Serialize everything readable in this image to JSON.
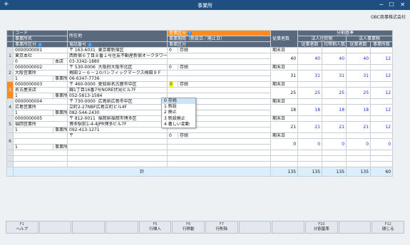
{
  "window": {
    "title": "事業所",
    "app_icon": "+"
  },
  "company": "OBC商事株式会社",
  "headers": {
    "code": "コード",
    "name": "事業所名",
    "office_type": "事業所区分",
    "address": "所在地",
    "phone": "電話番号",
    "biz_type": "営業区分",
    "period": "事業期間（新設日／廃止日）",
    "period2": "事業区分",
    "employees": "従業者数",
    "split": "分割基準",
    "corp_tax": "法人住民税",
    "corp_biz": "法人事業税",
    "col1": "従業者数",
    "col2": "均等割人数",
    "col3": "従業者数",
    "col4": "事業所数"
  },
  "rows": [
    {
      "n": "1",
      "code": "0000000001",
      "name": "東京本社",
      "type_code": "0",
      "type": "本店",
      "zip": "〒 163-6031",
      "addr1": "東京都新宿区",
      "addr2": "西新宿６丁目８番１号住友不動産新宿オークタワー",
      "phone": "03-3342-1880",
      "biz": "0",
      "biz_lbl": "存続",
      "term": "期末日",
      "c1": "40",
      "c2": "40",
      "c3": "40",
      "c4": "12"
    },
    {
      "n": "2",
      "code": "0000000002",
      "name": "大阪営業所",
      "type_code": "1",
      "type": "事業所",
      "zip": "〒 530-0006",
      "addr1": "大阪府大阪市北区",
      "addr2": "梅田２－６－２0パシフィックマークス梅田９Ｆ",
      "phone": "06-6347-7736",
      "biz": "0",
      "biz_lbl": "存続",
      "term": "期末日",
      "c1": "31",
      "c2": "31",
      "c3": "31",
      "c4": "12"
    },
    {
      "n": "3",
      "code": "0000000003",
      "name": "名古屋支店",
      "type_code": "1",
      "type": "事業所",
      "zip": "〒 460-0000",
      "addr1": "愛知県名古屋市中区",
      "addr2": "錦1丁目16番7号NORE伏見ビル7F",
      "phone": "052-5813-1584",
      "biz": "0",
      "biz_lbl": "存続",
      "term": "期末日",
      "c1": "25",
      "c2": "25",
      "c3": "25",
      "c4": "12"
    },
    {
      "n": "4",
      "code": "0000000004",
      "name": "広島営業所",
      "type_code": "1",
      "type": "事業所",
      "zip": "〒 730-0000",
      "addr1": "広島県広島市中区",
      "addr2": "立町2-27NBF広島立町ビル4F",
      "phone": "082-544-2430",
      "biz": "",
      "biz_lbl": "",
      "term": "期末日",
      "c1": "18",
      "c2": "18",
      "c3": "18",
      "c4": "12"
    },
    {
      "n": "5",
      "code": "0000000005",
      "name": "福岡営業所",
      "type_code": "1",
      "type": "事業所",
      "zip": "〒 812-0011",
      "addr1": "福岡県福岡市博多区",
      "addr2": "博多駅前1-4-4JPR博多ビル7F",
      "phone": "092-413-1271",
      "biz": "",
      "biz_lbl": "",
      "term": "期末日",
      "c1": "21",
      "c2": "21",
      "c3": "21",
      "c4": "12"
    },
    {
      "n": "6",
      "code": "",
      "name": "",
      "type_code": "1",
      "type": "事業所",
      "zip": "〒",
      "addr1": "",
      "addr2": "",
      "phone": "",
      "biz": "0",
      "biz_lbl": "存続",
      "term": "期末日",
      "c1": "0",
      "c2": "0",
      "c3": "0",
      "c4": "0"
    }
  ],
  "dropdown": {
    "options": [
      "0 存続",
      "1 新設",
      "2 廃止",
      "3 新設廃止",
      "4 著しい変動"
    ],
    "selected_index": 0
  },
  "total": {
    "label": "計",
    "c0": "135",
    "c1": "135",
    "c2": "135",
    "c3": "135",
    "c4": "60"
  },
  "fkeys": [
    {
      "key": "F1",
      "label": "ヘルプ"
    },
    {
      "key": "",
      "label": ""
    },
    {
      "key": "",
      "label": ""
    },
    {
      "key": "",
      "label": ""
    },
    {
      "key": "F5",
      "label": "行挿入"
    },
    {
      "key": "F6",
      "label": "行移動"
    },
    {
      "key": "F7",
      "label": "行削除"
    },
    {
      "key": "",
      "label": ""
    },
    {
      "key": "",
      "label": ""
    },
    {
      "key": "F10",
      "label": "分割基準"
    },
    {
      "key": "",
      "label": ""
    },
    {
      "key": "F12",
      "label": "閉じる"
    }
  ]
}
